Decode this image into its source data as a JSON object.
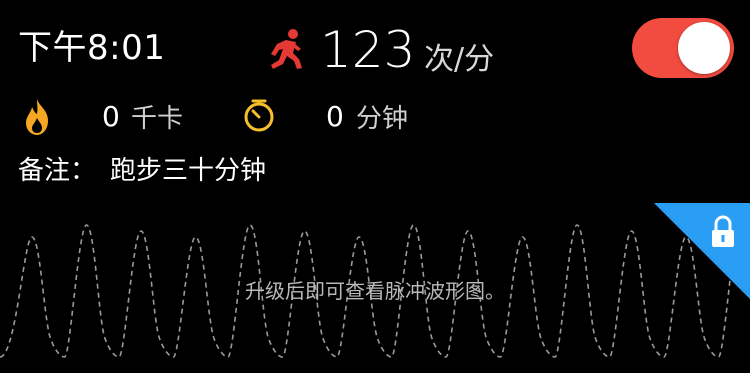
{
  "header": {
    "time": "下午8:01",
    "heart_rate_value": "123",
    "heart_rate_unit": "次/分",
    "toggle_on": true
  },
  "stats": {
    "calories_value": "0",
    "calories_unit": "千卡",
    "duration_value": "0",
    "duration_unit": "分钟"
  },
  "note": {
    "label": "备注：",
    "text": "跑步三十分钟"
  },
  "waveform": {
    "upgrade_message": "升级后即可查看脉冲波形图。",
    "locked": true
  },
  "icons": {
    "runner": "running-person-icon",
    "fire": "flame-icon",
    "timer": "timer-icon",
    "lock": "lock-icon"
  },
  "colors": {
    "accent_red": "#e53935",
    "accent_orange": "#f5a623",
    "accent_yellow": "#f5c02a",
    "toggle_on": "#f24b40",
    "lock_blue": "#2a9df4"
  }
}
